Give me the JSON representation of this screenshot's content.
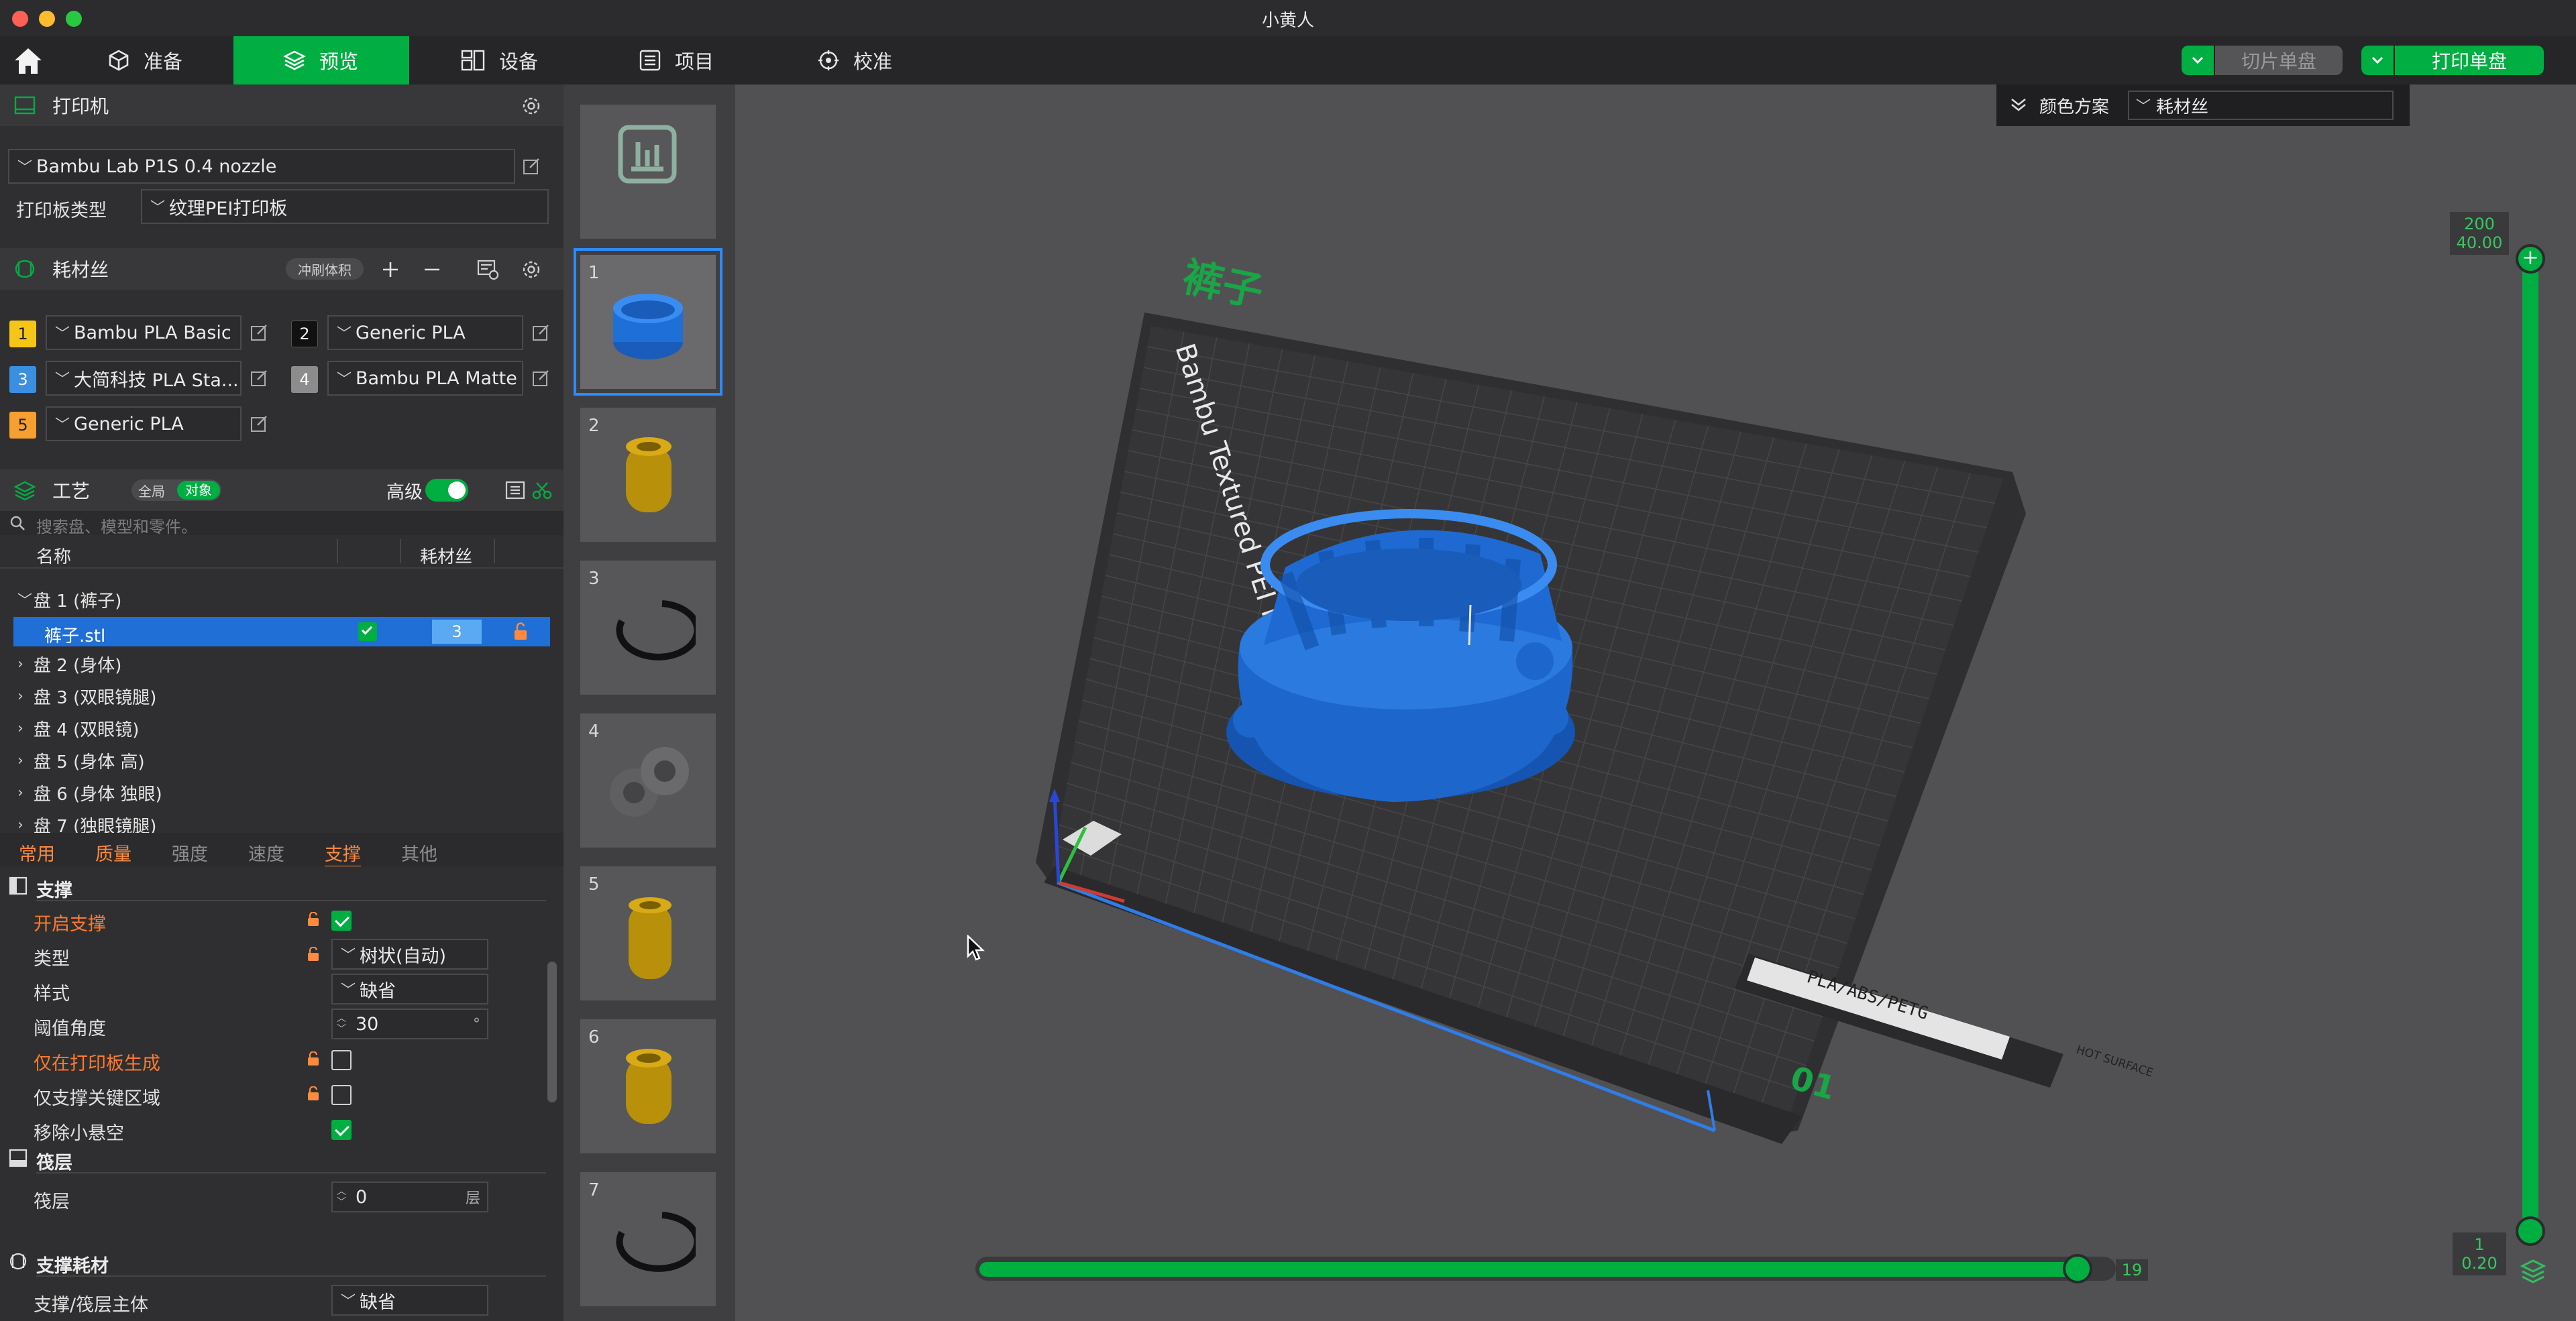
{
  "window": {
    "title": "小黄人"
  },
  "tabs": [
    {
      "label": "准备",
      "icon": "cube-icon"
    },
    {
      "label": "预览",
      "icon": "layers-icon",
      "active": true
    },
    {
      "label": "设备",
      "icon": "device-icon"
    },
    {
      "label": "项目",
      "icon": "project-icon"
    },
    {
      "label": "校准",
      "icon": "calibration-icon"
    }
  ],
  "actions": {
    "slice_label": "切片单盘",
    "print_label": "打印单盘"
  },
  "printer": {
    "section_title": "打印机",
    "name": "Bambu Lab P1S 0.4 nozzle",
    "plate_type_label": "打印板类型",
    "plate_type": "纹理PEI打印板"
  },
  "filament": {
    "section_title": "耗材丝",
    "flush_label": "冲刷体积",
    "items": [
      {
        "num": "1",
        "name": "Bambu PLA Basic",
        "color": "#f5c518"
      },
      {
        "num": "2",
        "name": "Generic PLA",
        "color": "#111111"
      },
      {
        "num": "3",
        "name": "大简科技 PLA Sta...",
        "color": "#3a8fe0"
      },
      {
        "num": "4",
        "name": "Bambu PLA Matte",
        "color": "#8c8c8c"
      },
      {
        "num": "5",
        "name": "Generic PLA",
        "color": "#f5a030"
      }
    ]
  },
  "process": {
    "section_title": "工艺",
    "global_label": "全局",
    "object_label": "对象",
    "advanced_label": "高级",
    "search_placeholder": "搜索盘、模型和零件。",
    "col_name": "名称",
    "col_filament": "耗材丝",
    "tree": [
      {
        "label": "盘 1 (裤子)",
        "expanded": true
      },
      {
        "label": "裤子.stl",
        "child": true,
        "filament": "3",
        "selected": true
      },
      {
        "label": "盘 2 (身体)"
      },
      {
        "label": "盘 3 (双眼镜腿)"
      },
      {
        "label": "盘 4 (双眼镜)"
      },
      {
        "label": "盘 5 (身体 高)"
      },
      {
        "label": "盘 6 (身体 独眼)"
      },
      {
        "label": "盘 7 (独眼镜腿)"
      }
    ],
    "tabs": [
      "常用",
      "质量",
      "强度",
      "速度",
      "支撑",
      "其他"
    ]
  },
  "support": {
    "group_title": "支撑",
    "enable_label": "开启支撑",
    "type_label": "类型",
    "type_value": "树状(自动)",
    "style_label": "样式",
    "style_value": "缺省",
    "angle_label": "阈值角度",
    "angle_value": "30",
    "angle_unit": "°",
    "build_plate_only_label": "仅在打印板生成",
    "critical_only_label": "仅支撑关键区域",
    "remove_small_label": "移除小悬空"
  },
  "raft": {
    "group_title": "筏层",
    "raft_label": "筏层",
    "raft_value": "0",
    "raft_unit": "层"
  },
  "support_filament": {
    "group_title": "支撑耗材",
    "base_label": "支撑/筏层主体",
    "base_value": "缺省"
  },
  "plates": [
    {
      "num": "",
      "kind": "placeholder"
    },
    {
      "num": "1",
      "kind": "pants"
    },
    {
      "num": "2",
      "kind": "body"
    },
    {
      "num": "3",
      "kind": "ring"
    },
    {
      "num": "4",
      "kind": "glasses"
    },
    {
      "num": "5",
      "kind": "body"
    },
    {
      "num": "6",
      "kind": "body"
    },
    {
      "num": "7",
      "kind": "ring"
    }
  ],
  "viewport": {
    "color_scheme_label": "颜色方案",
    "color_scheme_value": "耗材丝",
    "plate_name": "裤子",
    "plate_text": "Bambu Textured PEI Plate",
    "plate_material": "PLA/ABS/PETG",
    "plate_warning": "HOT SURFACE",
    "plate_number": "01",
    "layer_top_count": "200",
    "layer_top_height": "40.00",
    "layer_bottom_count": "1",
    "layer_bottom_height": "0.20",
    "move_value": "19",
    "move_fraction": 0.97
  },
  "colors": {
    "accent": "#00ae42",
    "selection": "#1f6fd6",
    "modified": "#ff7a2e",
    "object": "#1e6fd8"
  }
}
